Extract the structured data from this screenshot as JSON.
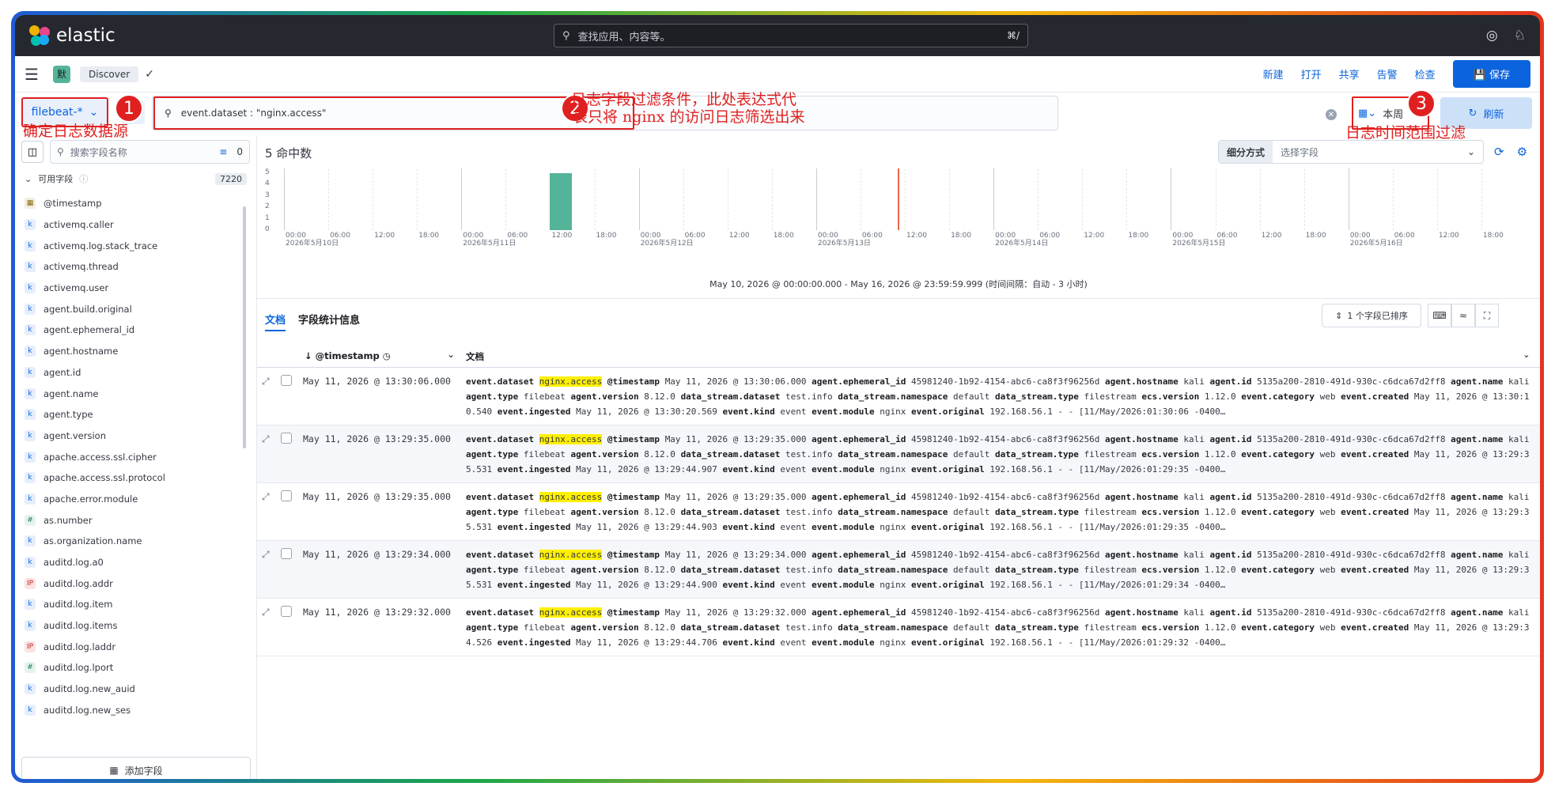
{
  "brand": {
    "name": "elastic"
  },
  "global_search": {
    "placeholder": "查找应用、内容等。",
    "shortcut": "⌘/"
  },
  "app_header": {
    "space_initial": "默",
    "breadcrumb": "Discover"
  },
  "toolbar": {
    "new": "新建",
    "open": "打开",
    "share": "共享",
    "alerts": "告警",
    "inspect": "检查",
    "save": "保存"
  },
  "query_bar": {
    "data_view": "filebeat-*",
    "query": "event.dataset : \"nginx.access\"",
    "date_range": "本周",
    "refresh": "刷新"
  },
  "annotations": {
    "badge1": "1",
    "badge2": "2",
    "badge3": "3",
    "note1": "确定日志数据源",
    "note2_line1": "日志字段过滤条件，此处表达式代",
    "note2_line2": "表只将 nginx 的访问日志筛选出来",
    "note3": "日志时间范围过滤"
  },
  "sidebar": {
    "search_placeholder": "搜索字段名称",
    "filter_count": "0",
    "available_label": "可用字段",
    "available_count": "7220",
    "fields": [
      {
        "name": "@timestamp",
        "type": "date"
      },
      {
        "name": "activemq.caller",
        "type": "k"
      },
      {
        "name": "activemq.log.stack_trace",
        "type": "k"
      },
      {
        "name": "activemq.thread",
        "type": "k"
      },
      {
        "name": "activemq.user",
        "type": "k"
      },
      {
        "name": "agent.build.original",
        "type": "k"
      },
      {
        "name": "agent.ephemeral_id",
        "type": "k"
      },
      {
        "name": "agent.hostname",
        "type": "k"
      },
      {
        "name": "agent.id",
        "type": "k"
      },
      {
        "name": "agent.name",
        "type": "k"
      },
      {
        "name": "agent.type",
        "type": "k"
      },
      {
        "name": "agent.version",
        "type": "k"
      },
      {
        "name": "apache.access.ssl.cipher",
        "type": "k"
      },
      {
        "name": "apache.access.ssl.protocol",
        "type": "k"
      },
      {
        "name": "apache.error.module",
        "type": "k"
      },
      {
        "name": "as.number",
        "type": "#"
      },
      {
        "name": "as.organization.name",
        "type": "k"
      },
      {
        "name": "auditd.log.a0",
        "type": "k"
      },
      {
        "name": "auditd.log.addr",
        "type": "ip"
      },
      {
        "name": "auditd.log.item",
        "type": "k"
      },
      {
        "name": "auditd.log.items",
        "type": "k"
      },
      {
        "name": "auditd.log.laddr",
        "type": "ip"
      },
      {
        "name": "auditd.log.lport",
        "type": "#"
      },
      {
        "name": "auditd.log.new_auid",
        "type": "k"
      },
      {
        "name": "auditd.log.new_ses",
        "type": "k"
      }
    ],
    "add_field": "添加字段"
  },
  "main": {
    "hits": "5 命中数",
    "breakdown_label": "细分方式",
    "breakdown_placeholder": "选择字段",
    "time_range": "May 10, 2026 @ 00:00:00.000 - May 16, 2026 @ 23:59:59.999  (时间间隔：自动 - 3 小时)",
    "tab_documents": "文档",
    "tab_field_stats": "字段统计信息",
    "sort_label": "1 个字段已排序",
    "col_timestamp": "@timestamp",
    "col_document": "文档"
  },
  "chart_data": {
    "type": "bar",
    "title": "",
    "xlabel": "",
    "ylabel": "",
    "ylim": [
      0,
      5
    ],
    "y_ticks": [
      "5",
      "4",
      "3",
      "2",
      "1",
      "0"
    ],
    "days": [
      "2026年5月10日",
      "2026年5月11日",
      "2026年5月12日",
      "2026年5月13日",
      "2026年5月14日",
      "2026年5月15日",
      "2026年5月16日"
    ],
    "hour_ticks": [
      "00:00",
      "06:00",
      "12:00",
      "18:00"
    ],
    "interval_hours": 3,
    "bars": [
      {
        "day_index": 1,
        "start_hour": 12,
        "value": 5
      }
    ],
    "now_marker": {
      "day_index": 3,
      "hour": 11
    }
  },
  "documents": [
    {
      "time": "May 11, 2026 @ 13:30:06.000",
      "created": "May 11, 2026 @ 13:30:10.540",
      "ingested": "May 11, 2026 @ 13:30:20.569",
      "original": "192.168.56.1 - - [11/May/2026:01:30:06 -0400…"
    },
    {
      "time": "May 11, 2026 @ 13:29:35.000",
      "created": "May 11, 2026 @ 13:29:35.531",
      "ingested": "May 11, 2026 @ 13:29:44.907",
      "original": "192.168.56.1 - - [11/May/2026:01:29:35 -0400…"
    },
    {
      "time": "May 11, 2026 @ 13:29:35.000",
      "created": "May 11, 2026 @ 13:29:35.531",
      "ingested": "May 11, 2026 @ 13:29:44.903",
      "original": "192.168.56.1 - - [11/May/2026:01:29:35 -0400…"
    },
    {
      "time": "May 11, 2026 @ 13:29:34.000",
      "created": "May 11, 2026 @ 13:29:35.531",
      "ingested": "May 11, 2026 @ 13:29:44.900",
      "original": "192.168.56.1 - - [11/May/2026:01:29:34 -0400…"
    },
    {
      "time": "May 11, 2026 @ 13:29:32.000",
      "created": "May 11, 2026 @ 13:29:34.526",
      "ingested": "May 11, 2026 @ 13:29:44.706",
      "original": "192.168.56.1 - - [11/May/2026:01:29:32 -0400…"
    }
  ],
  "doc_common": {
    "dataset": "nginx.access",
    "ephemeral_id": "45981240-1b92-4154-abc6-ca8f3f96256d",
    "hostname": "kali",
    "agent_id": "5135a200-2810-491d-930c-c6dca67d2ff8",
    "agent_name": "kali",
    "agent_type": "filebeat",
    "agent_version": "8.12.0",
    "ds_dataset": "test.info",
    "ds_namespace": "default",
    "ds_type": "filestream",
    "ecs_version": "1.12.0",
    "category": "web",
    "kind": "event",
    "module": "nginx"
  },
  "colors": {
    "accent": "#0b64dd",
    "bar": "#54b399",
    "annotation": "#e02020",
    "now_marker": "#e7664c",
    "highlight": "#fff000"
  }
}
